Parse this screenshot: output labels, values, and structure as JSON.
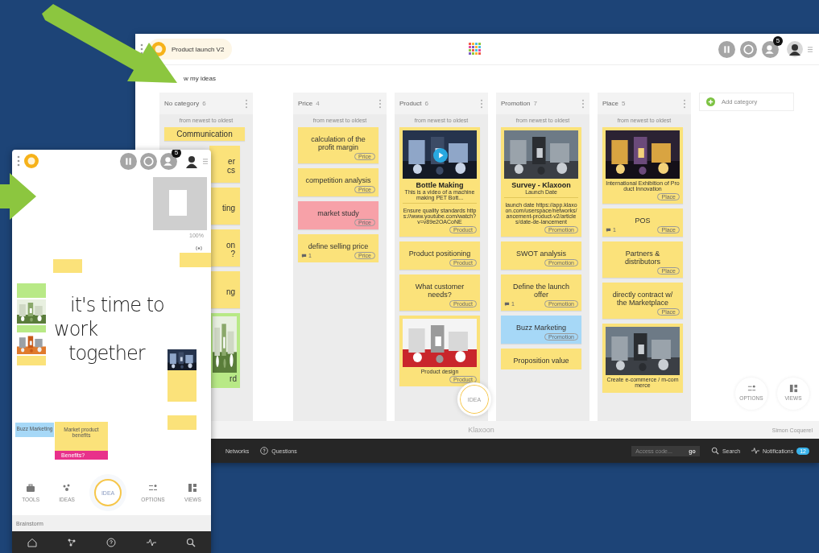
{
  "desktop": {
    "board_title": "Product launch V2",
    "participants_badge": "5",
    "show_ideas_label": "w my ideas",
    "columns": [
      {
        "name": "No category",
        "count": "6",
        "sort_label": "from newest to oldest",
        "cards": [
          {
            "kind": "note",
            "text": "Communication",
            "color": "#fbe27a"
          },
          {
            "kind": "note",
            "text": "er\ncs",
            "color": "#fbe27a"
          },
          {
            "kind": "note",
            "text": "ting",
            "color": "#fbe27a"
          },
          {
            "kind": "note",
            "text": "on\n?",
            "color": "#fbe27a"
          },
          {
            "kind": "note",
            "text": "ng",
            "color": "#fbe27a"
          },
          {
            "kind": "media",
            "text": "rd",
            "color": "#b8e986"
          }
        ]
      },
      {
        "name": "Price",
        "count": "4",
        "sort_label": "from newest to oldest",
        "cards": [
          {
            "kind": "note",
            "text": "calculation of the profit margin",
            "tag": "Price",
            "color": "#fbe27a"
          },
          {
            "kind": "note",
            "text": "competition analysis",
            "tag": "Price",
            "color": "#fbe27a"
          },
          {
            "kind": "note",
            "text": "market study",
            "tag": "Price",
            "color": "#f7a1a8"
          },
          {
            "kind": "note",
            "text": "define selling price",
            "tag": "Price",
            "comments": "1",
            "color": "#fbe27a"
          }
        ]
      },
      {
        "name": "Product",
        "count": "6",
        "sort_label": "from newest to oldest",
        "cards": [
          {
            "kind": "video",
            "title": "Bottle Making",
            "subtitle": "This is a video of a machine making PET Bott...",
            "text": "Ensure quality standards https://www.youtube.com/watch?v=v89e2OACoNE",
            "tag": "Product",
            "color": "#fbe27a"
          },
          {
            "kind": "note",
            "text": "Product positioning",
            "tag": "Product",
            "color": "#fbe27a"
          },
          {
            "kind": "note",
            "text": "What customer needs?",
            "tag": "Product",
            "color": "#fbe27a"
          },
          {
            "kind": "media",
            "text": "Product design",
            "tag": "Product",
            "color": "#fbe27a"
          }
        ]
      },
      {
        "name": "Promotion",
        "count": "7",
        "sort_label": "from newest to oldest",
        "cards": [
          {
            "kind": "media",
            "title": "Survey - Klaxoon",
            "subtitle": "Launch Date",
            "text": "launch date https://app.klaxoon.com/userspace/networks/ancement-product-v2/articles/date-de-lancement",
            "tag": "Promotion",
            "color": "#fbe27a"
          },
          {
            "kind": "note",
            "text": "SWOT analysis",
            "tag": "Promotion",
            "color": "#fbe27a"
          },
          {
            "kind": "note",
            "text": "Define the launch offer",
            "tag": "Promotion",
            "comments": "1",
            "color": "#fbe27a"
          },
          {
            "kind": "note",
            "text": "Buzz Marketing",
            "tag": "Promotion",
            "color": "#a6d8f7"
          },
          {
            "kind": "note",
            "text": "Proposition value",
            "color": "#fbe27a"
          }
        ]
      },
      {
        "name": "Place",
        "count": "5",
        "sort_label": "from newest to oldest",
        "cards": [
          {
            "kind": "media",
            "text": "International Exhibition of Product Innovation",
            "tag": "Place",
            "color": "#fbe27a"
          },
          {
            "kind": "note",
            "text": "POS",
            "tag": "Place",
            "comments": "1",
            "color": "#fbe27a"
          },
          {
            "kind": "note",
            "text": "Partners & distributors",
            "tag": "Place",
            "color": "#fbe27a"
          },
          {
            "kind": "note",
            "text": "directly contract w/ the Marketplace",
            "tag": "Place",
            "color": "#fbe27a"
          },
          {
            "kind": "media",
            "text": "Create e-commerce / m-commerce",
            "color": "#fbe27a"
          }
        ]
      }
    ],
    "add_category": "Add category",
    "idea_button": "IDEA",
    "side_buttons": [
      {
        "kind": "options",
        "label": "OPTIONS"
      },
      {
        "kind": "views",
        "label": "VIEWS"
      }
    ],
    "brand": "Klaxoon",
    "user_name": "Simon Coquerel",
    "bottom_bar": {
      "links": [
        {
          "kind": "networks",
          "label": "Networks"
        },
        {
          "kind": "questions",
          "label": "Questions"
        }
      ],
      "access_code": {
        "placeholder": "Access code..."
      },
      "go_button": "go",
      "search": "Search",
      "notifications": "Notifications",
      "notifications_badge": "12"
    }
  },
  "mobile": {
    "participants_badge": "5",
    "zoom_label": "100%",
    "handwriting": [
      "it's time to",
      "work",
      "together"
    ],
    "stickies": [
      {
        "text": "Buzz Marketing",
        "color": "#a6d8f7"
      },
      {
        "text": "Market product benefits",
        "color": "#fbe27a"
      }
    ],
    "alert_label": "Benefits?",
    "toolbar": [
      {
        "kind": "tools",
        "label": "TOOLS"
      },
      {
        "kind": "ideas",
        "label": "IDEAS"
      },
      {
        "kind": "idea",
        "label": "IDEA"
      },
      {
        "kind": "options",
        "label": "OPTIONS"
      },
      {
        "kind": "views",
        "label": "VIEWS"
      }
    ],
    "session_title": "Brainstorm"
  }
}
